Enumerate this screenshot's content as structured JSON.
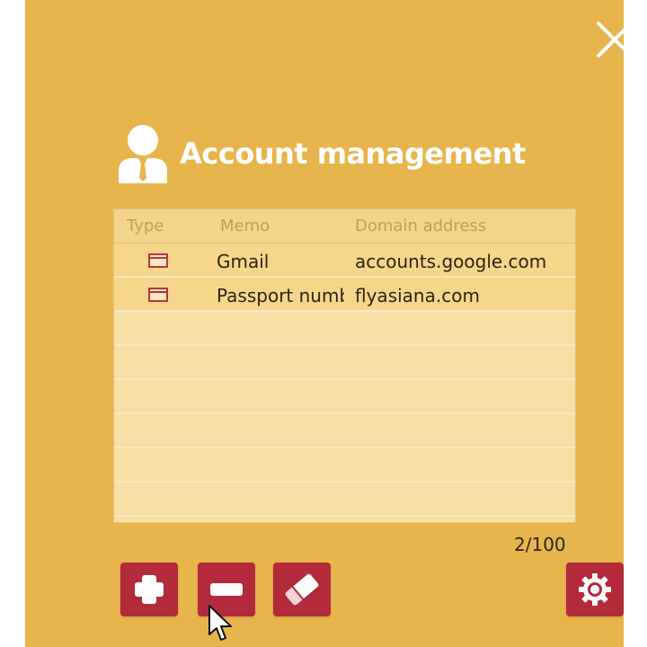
{
  "dialog": {
    "title": "Account management",
    "close_icon": "close-icon",
    "avatar_icon": "user-avatar-icon"
  },
  "table": {
    "columns": [
      "Type",
      "Memo",
      "Domain address"
    ],
    "rows": [
      {
        "type_icon": "card-icon",
        "memo": "Gmail",
        "domain": "accounts.google.com"
      },
      {
        "type_icon": "card-icon",
        "memo": "Passport number",
        "domain": "flyasiana.com"
      }
    ],
    "empty_rows": 6
  },
  "counter": "2/100",
  "toolbar": {
    "buttons": [
      {
        "name": "add-button",
        "icon": "plus-icon"
      },
      {
        "name": "remove-button",
        "icon": "minus-icon"
      },
      {
        "name": "erase-button",
        "icon": "eraser-icon"
      },
      {
        "name": "settings-button",
        "icon": "gear-icon"
      }
    ]
  },
  "colors": {
    "panel_bg": "#e8b54d",
    "accent": "#b32a3a",
    "table_bg": "#f5dc9d"
  }
}
